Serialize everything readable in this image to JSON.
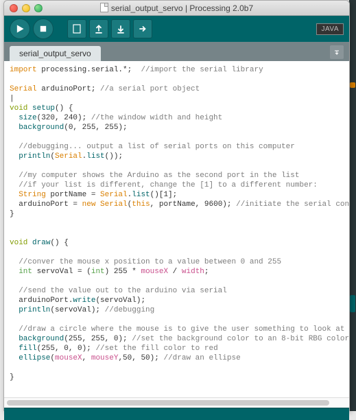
{
  "window": {
    "title": "serial_output_servo | Processing 2.0b7"
  },
  "toolbar": {
    "mode_badge": "JAVA"
  },
  "tab": {
    "name": "serial_output_servo"
  },
  "code": {
    "l1a": "import",
    "l1b": " processing.serial.*;  ",
    "l1c": "//import the serial library",
    "l3a": "Serial",
    "l3b": " arduinoPort; ",
    "l3c": "//a serial port object",
    "l5a": "void",
    "l5b": " ",
    "l5c": "setup",
    "l5d": "() {",
    "l6a": "  ",
    "l6b": "size",
    "l6c": "(320, 240); ",
    "l6d": "//the window width and height",
    "l7a": "  ",
    "l7b": "background",
    "l7c": "(0, 255, 255);",
    "l9a": "  ",
    "l9b": "//debugging... output a list of serial ports on this computer",
    "l10a": "  ",
    "l10b": "println",
    "l10c": "(",
    "l10d": "Serial",
    "l10e": ".",
    "l10f": "list",
    "l10g": "());",
    "l12a": "  ",
    "l12b": "//my computer shows the Arduino as the second port in the list",
    "l13a": "  ",
    "l13b": "//if your list is different, change the [1] to a different number:",
    "l14a": "  ",
    "l14b": "String",
    "l14c": " portName = ",
    "l14d": "Serial",
    "l14e": ".",
    "l14f": "list",
    "l14g": "()[1];",
    "l15a": "  arduinoPort = ",
    "l15b": "new",
    "l15c": " ",
    "l15d": "Serial",
    "l15e": "(",
    "l15f": "this",
    "l15g": ", portName, 9600); ",
    "l15h": "//initiate the serial connectio",
    "l16": "}",
    "l19a": "void",
    "l19b": " ",
    "l19c": "draw",
    "l19d": "() {",
    "l21a": "  ",
    "l21b": "//conver the mouse x position to a value between 0 and 255",
    "l22a": "  ",
    "l22b": "int",
    "l22c": " servoVal = (",
    "l22d": "int",
    "l22e": ") 255 * ",
    "l22f": "mouseX",
    "l22g": " / ",
    "l22h": "width",
    "l22i": ";",
    "l24a": "  ",
    "l24b": "//send the value out to the arduino via serial",
    "l25a": "  arduinoPort.",
    "l25b": "write",
    "l25c": "(servoVal);",
    "l26a": "  ",
    "l26b": "println",
    "l26c": "(servoVal); ",
    "l26d": "//debugging",
    "l28a": "  ",
    "l28b": "//draw a circle where the mouse is to give the user something to look at",
    "l29a": "  ",
    "l29b": "background",
    "l29c": "(255, 255, 0); ",
    "l29d": "//set the background color to an 8-bit RBG color",
    "l30a": "  ",
    "l30b": "fill",
    "l30c": "(255, 0, 0); ",
    "l30d": "//set the fill color to red",
    "l31a": "  ",
    "l31b": "ellipse",
    "l31c": "(",
    "l31d": "mouseX",
    "l31e": ", ",
    "l31f": "mouseY",
    "l31g": ",50, 50); ",
    "l31h": "//draw an ellipse",
    "l33": "}"
  }
}
